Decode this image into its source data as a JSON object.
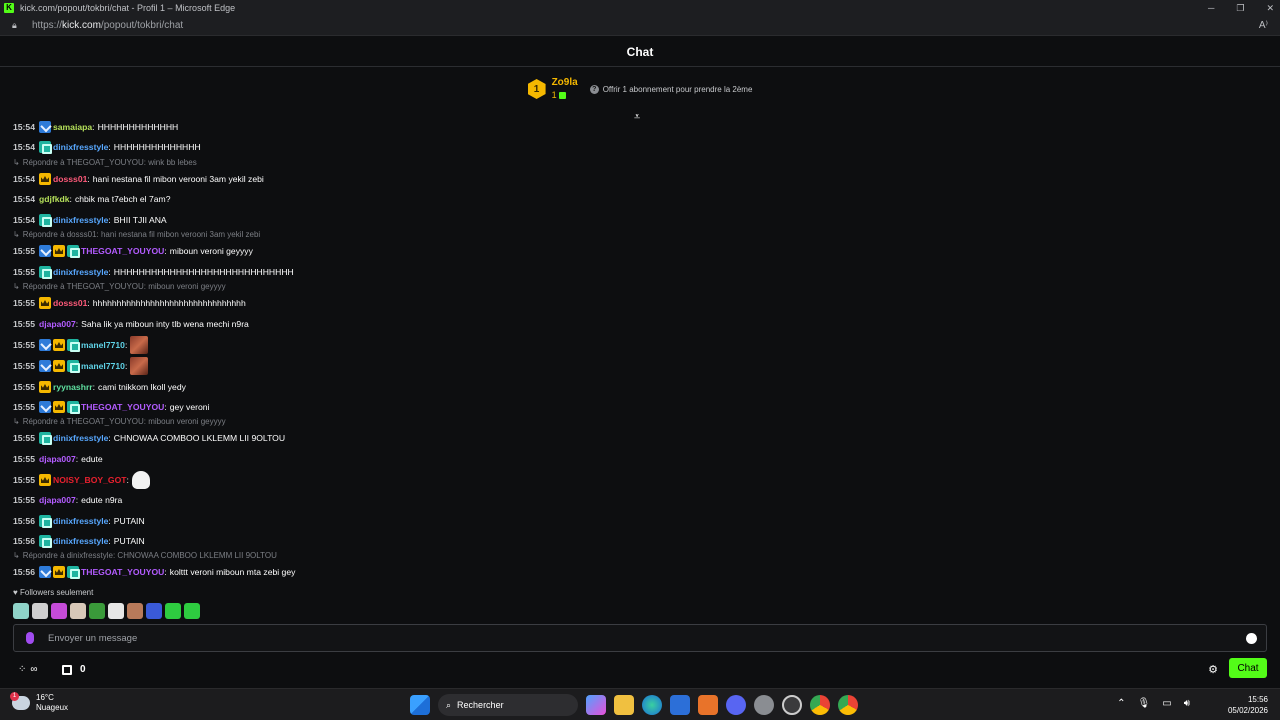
{
  "browser": {
    "window_title": "kick.com/popout/tokbri/chat - Profil 1 – Microsoft Edge",
    "url_prefix": "https://",
    "url_domain": "kick.com",
    "url_path": "/popout/tokbri/chat"
  },
  "header": {
    "title": "Chat"
  },
  "pinned": {
    "rank": "1",
    "username": "Zo9la",
    "count": "1",
    "offer_text": "Offrir 1 abonnement pour prendre la 2ème"
  },
  "messages": [
    {
      "time": "15:54",
      "user": "samaiapa",
      "text": "HHHHHHHHHHHHH",
      "color": "#b4e05a",
      "badges": [
        "og"
      ]
    },
    {
      "time": "15:54",
      "user": "dinixfresstyle",
      "text": "HHHHHHHHHHHHHH",
      "color": "#58a8ff",
      "badges": [
        "gift"
      ]
    },
    {
      "reply": "Répondre à THEGOAT_YOUYOU: wink bb lebes"
    },
    {
      "time": "15:54",
      "user": "dosss01",
      "text": "hani nestana fil mibon verooni 3am yekil zebi",
      "color": "#ff5a7a",
      "badges": [
        "sub"
      ]
    },
    {
      "time": "15:54",
      "user": "gdjfkdk",
      "text": "chbik ma t7ebch el 7am?",
      "color": "#b4e05a",
      "badges": []
    },
    {
      "time": "15:54",
      "user": "dinixfresstyle",
      "text": "BHII TJII ANA",
      "color": "#58a8ff",
      "badges": [
        "gift"
      ]
    },
    {
      "reply": "Répondre à dosss01: hani nestana fil mibon verooni 3am yekil zebi"
    },
    {
      "time": "15:55",
      "user": "THEGOAT_YOUYOU",
      "text": "miboun veroni geyyyy",
      "color": "#b35cff",
      "badges": [
        "og",
        "sub",
        "gift"
      ]
    },
    {
      "time": "15:55",
      "user": "dinixfresstyle",
      "text": "HHHHHHHHHHHHHHHHHHHHHHHHHHHHH",
      "color": "#58a8ff",
      "badges": [
        "gift"
      ]
    },
    {
      "reply": "Répondre à THEGOAT_YOUYOU: miboun veroni geyyyy"
    },
    {
      "time": "15:55",
      "user": "dosss01",
      "text": "hhhhhhhhhhhhhhhhhhhhhhhhhhhhhhhh",
      "color": "#ff5a7a",
      "badges": [
        "sub"
      ]
    },
    {
      "time": "15:55",
      "user": "djapa007",
      "text": "Saha lik ya miboun inty tlb wena mechi n9ra",
      "color": "#b35cff",
      "badges": []
    },
    {
      "time": "15:55",
      "user": "manel7710",
      "text": "",
      "color": "#5fd3e8",
      "badges": [
        "og",
        "sub",
        "gift"
      ],
      "emote": "face"
    },
    {
      "time": "15:55",
      "user": "manel7710",
      "text": "",
      "color": "#5fd3e8",
      "badges": [
        "og",
        "sub",
        "gift"
      ],
      "emote": "face"
    },
    {
      "time": "15:55",
      "user": "ryynashrr",
      "text": "cami tnikkom lkoll yedy",
      "color": "#5fe0a0",
      "badges": [
        "sub"
      ]
    },
    {
      "time": "15:55",
      "user": "THEGOAT_YOUYOU",
      "text": "gey veroni",
      "color": "#b35cff",
      "badges": [
        "og",
        "sub",
        "gift"
      ]
    },
    {
      "reply": "Répondre à THEGOAT_YOUYOU: miboun veroni geyyyy"
    },
    {
      "time": "15:55",
      "user": "dinixfresstyle",
      "text": "CHNOWAA COMBOO LKLEMM LII 9OLTOU",
      "color": "#58a8ff",
      "badges": [
        "gift"
      ]
    },
    {
      "time": "15:55",
      "user": "djapa007",
      "text": "edute",
      "color": "#b35cff",
      "badges": []
    },
    {
      "time": "15:55",
      "user": "NOISY_BOY_GOT",
      "text": "",
      "color": "#e8202e",
      "badges": [
        "sub"
      ],
      "emote": "ghost"
    },
    {
      "time": "15:55",
      "user": "djapa007",
      "text": "edute n9ra",
      "color": "#b35cff",
      "badges": []
    },
    {
      "time": "15:56",
      "user": "dinixfresstyle",
      "text": "PUTAIN",
      "color": "#58a8ff",
      "badges": [
        "gift"
      ]
    },
    {
      "time": "15:56",
      "user": "dinixfresstyle",
      "text": "PUTAIN",
      "color": "#58a8ff",
      "badges": [
        "gift"
      ]
    },
    {
      "reply": "Répondre à dinixfresstyle: CHNOWAA COMBOO LKLEMM LII 9OLTOU"
    },
    {
      "time": "15:56",
      "user": "THEGOAT_YOUYOU",
      "text": "kolttt veroni miboun mta zebi gey",
      "color": "#b35cff",
      "badges": [
        "og",
        "sub",
        "gift"
      ]
    }
  ],
  "chat_mode": "Followers seulement",
  "quick_emotes": [
    "#8fd3c8",
    "#cfcfcf",
    "#c54bd8",
    "#d8c8b8",
    "#3a9a3a",
    "#e6e6e6",
    "#b87a5a",
    "#3a5ad8",
    "#2ecc40",
    "#2ecc40"
  ],
  "input": {
    "placeholder": "Envoyer un message"
  },
  "controls": {
    "points": "∞",
    "subs_count": "0",
    "chat_button": "Chat"
  },
  "taskbar": {
    "temperature": "16°C",
    "condition": "Nuageux",
    "weather_badge": "1",
    "search_label": "Rechercher",
    "time": "15:56",
    "date": "05/02/2026"
  },
  "colors": {
    "accent": "#53fc18",
    "gold": "#f5b800"
  }
}
